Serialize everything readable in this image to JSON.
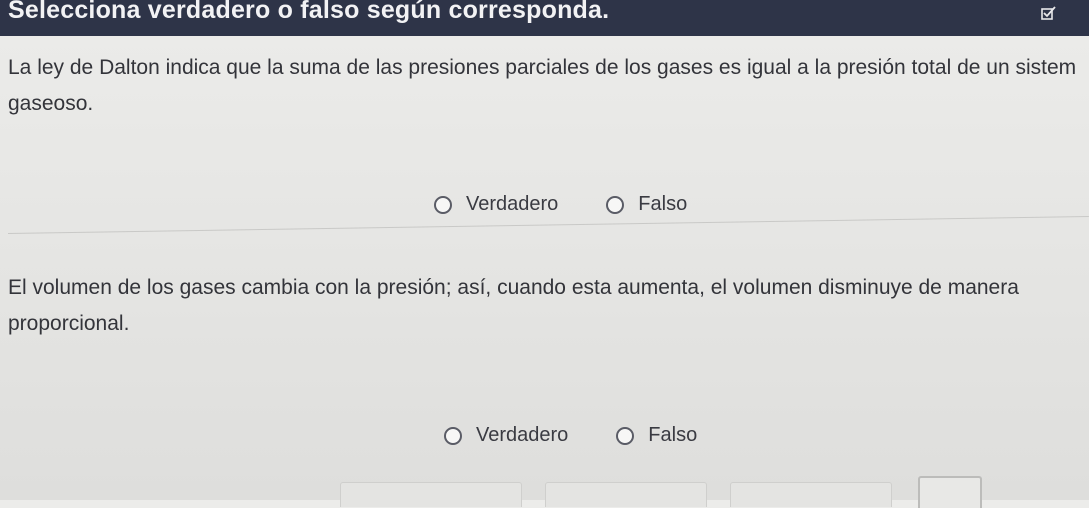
{
  "header": {
    "title": "Selecciona verdadero o falso según corresponda."
  },
  "questions": [
    {
      "text_line1": "La ley de Dalton indica que la suma de las presiones parciales de los gases es igual a la presión total de un sistem",
      "text_line2": "gaseoso.",
      "options": [
        "Verdadero",
        "Falso"
      ]
    },
    {
      "text_line1": "El volumen de los gases cambia con la presión; así, cuando esta aumenta, el volumen disminuye de manera",
      "text_line2": "proporcional.",
      "options": [
        "Verdadero",
        "Falso"
      ]
    }
  ],
  "icons": {
    "header_icon": "check-square-icon"
  },
  "colors": {
    "header_bg": "#2e3448",
    "header_text": "#f2f2f4",
    "body_text": "#33343a"
  }
}
